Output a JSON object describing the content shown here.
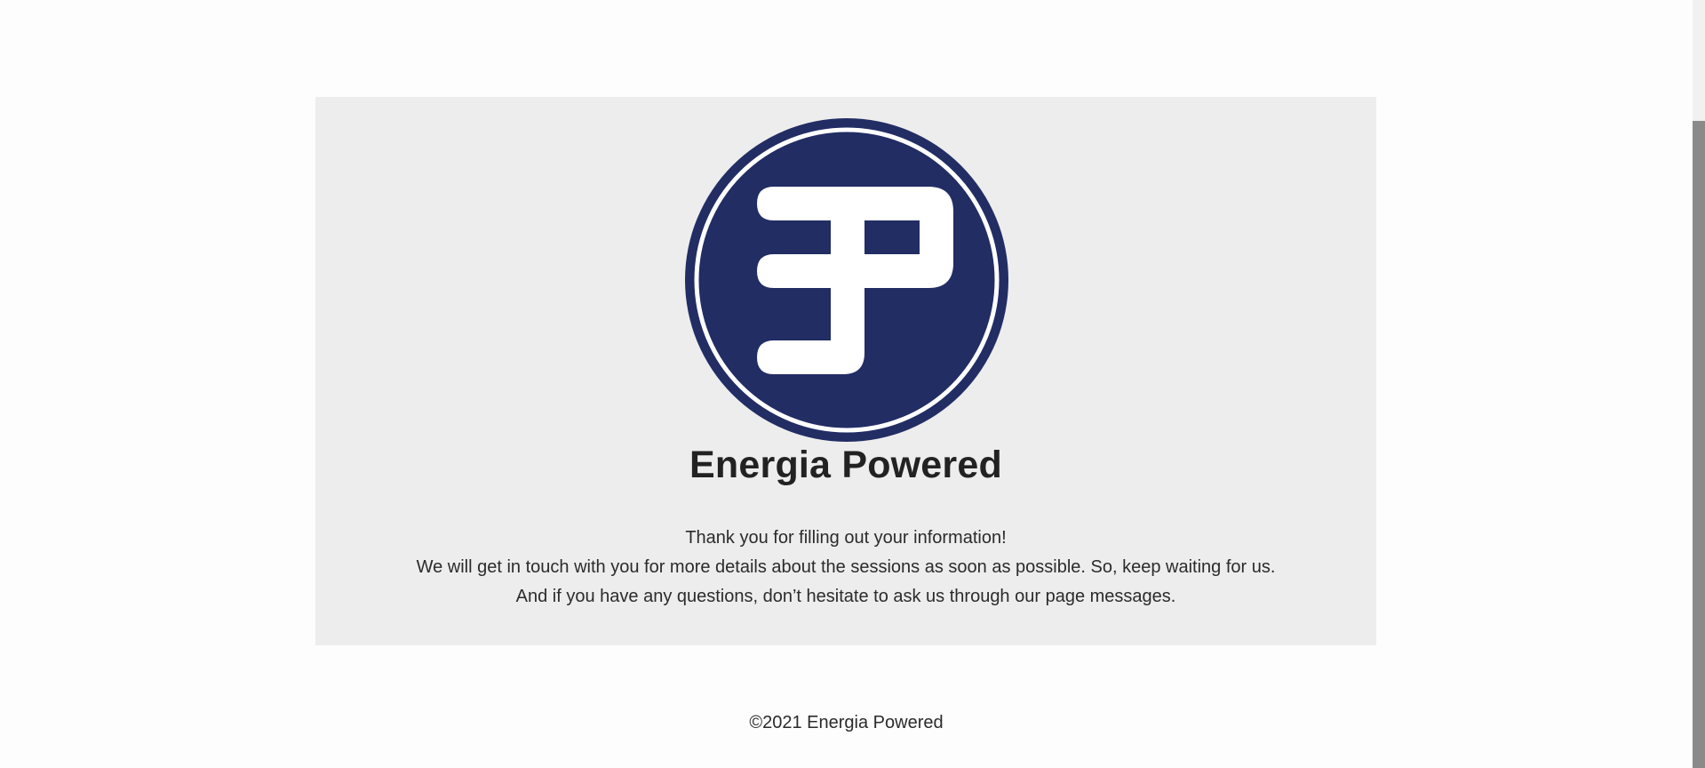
{
  "brand": {
    "name": "Energia Powered",
    "logo_icon": "energia-powered-ep-logo-icon",
    "logo_bg": "#222d64",
    "logo_fg": "#ffffff"
  },
  "confirmation": {
    "line1": "Thank you for filling out your information!",
    "line2": "We will get in touch with you for more details about the sessions as soon as possible. So, keep waiting for us.",
    "line3": "And if you have any questions, don’t hesitate to ask us through our page messages."
  },
  "footer": {
    "copyright": "©2021 Energia Powered"
  },
  "colors": {
    "card_bg": "#ededed",
    "text": "#2b2b2b"
  }
}
